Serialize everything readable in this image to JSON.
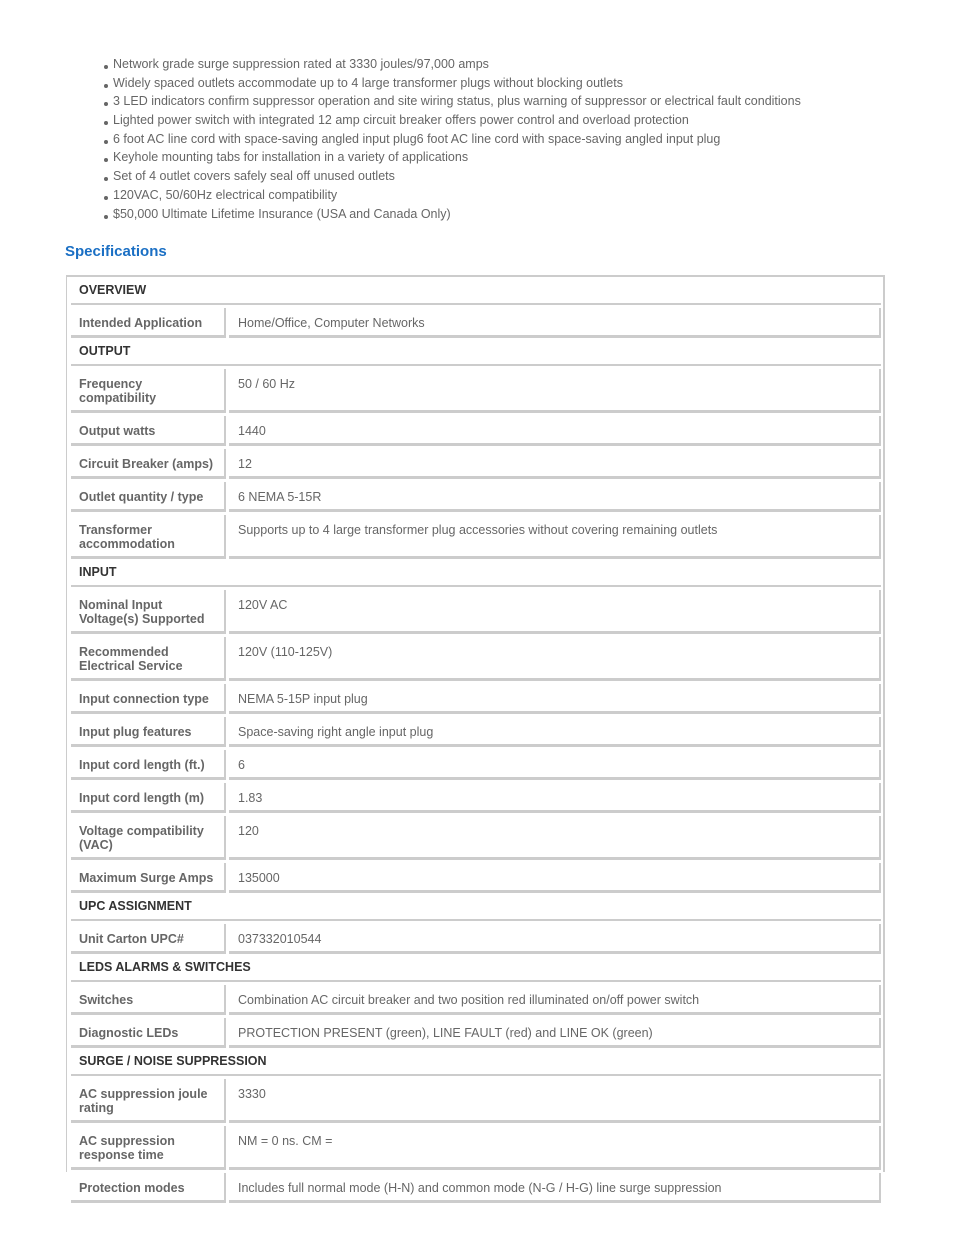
{
  "features": [
    "Network grade surge suppression rated at 3330 joules/97,000 amps",
    "Widely spaced outlets accommodate up to 4 large transformer plugs without blocking outlets",
    "3 LED indicators confirm suppressor operation and site wiring status, plus warning of suppressor or electrical fault conditions",
    "Lighted power switch with integrated 12 amp circuit breaker offers power control and overload protection",
    "6 foot AC line cord with space-saving angled input plug6 foot AC line cord with space-saving angled input plug",
    "Keyhole mounting tabs for installation in a variety of applications",
    "Set of 4 outlet covers safely seal off unused outlets",
    "120VAC, 50/60Hz electrical compatibility",
    "$50,000 Ultimate Lifetime Insurance (USA and Canada Only)"
  ],
  "specifications": {
    "title": "Specifications",
    "sections": [
      {
        "name": "OVERVIEW",
        "rows": [
          {
            "label": "Intended Application",
            "value": "Home/Office, Computer Networks"
          }
        ]
      },
      {
        "name": "OUTPUT",
        "rows": [
          {
            "label": "Frequency compatibility",
            "value": "50 / 60 Hz"
          },
          {
            "label": "Output watts",
            "value": "1440"
          },
          {
            "label": "Circuit Breaker (amps)",
            "value": "12"
          },
          {
            "label": "Outlet quantity / type",
            "value": "6 NEMA 5-15R"
          },
          {
            "label": "Transformer accommodation",
            "value": "Supports up to 4 large transformer plug accessories without covering remaining outlets"
          }
        ]
      },
      {
        "name": "INPUT",
        "rows": [
          {
            "label": "Nominal Input Voltage(s) Supported",
            "value": "120V AC"
          },
          {
            "label": "Recommended Electrical Service",
            "value": "120V (110-125V)"
          },
          {
            "label": "Input connection type",
            "value": "NEMA 5-15P input plug"
          },
          {
            "label": "Input plug features",
            "value": "Space-saving right angle input plug"
          },
          {
            "label": "Input cord length (ft.)",
            "value": "6"
          },
          {
            "label": "Input cord length (m)",
            "value": "1.83"
          },
          {
            "label": "Voltage compatibility (VAC)",
            "value": "120"
          },
          {
            "label": "Maximum Surge Amps",
            "value": "135000"
          }
        ]
      },
      {
        "name": "UPC ASSIGNMENT",
        "rows": [
          {
            "label": "Unit Carton UPC#",
            "value": "037332010544"
          }
        ]
      },
      {
        "name": "LEDS ALARMS & SWITCHES",
        "rows": [
          {
            "label": "Switches",
            "value": "Combination AC circuit breaker and two position red illuminated on/off power switch"
          },
          {
            "label": "Diagnostic LEDs",
            "value": "PROTECTION PRESENT (green), LINE FAULT (red) and LINE OK (green)"
          }
        ]
      },
      {
        "name": "SURGE / NOISE SUPPRESSION",
        "rows": [
          {
            "label": "AC suppression joule rating",
            "value": "3330"
          },
          {
            "label": "AC suppression response time",
            "value": "NM = 0 ns. CM ="
          },
          {
            "label": "Protection modes",
            "value": "Includes full normal mode (H-N) and common mode (N-G / H-G) line surge suppression"
          }
        ]
      }
    ]
  }
}
